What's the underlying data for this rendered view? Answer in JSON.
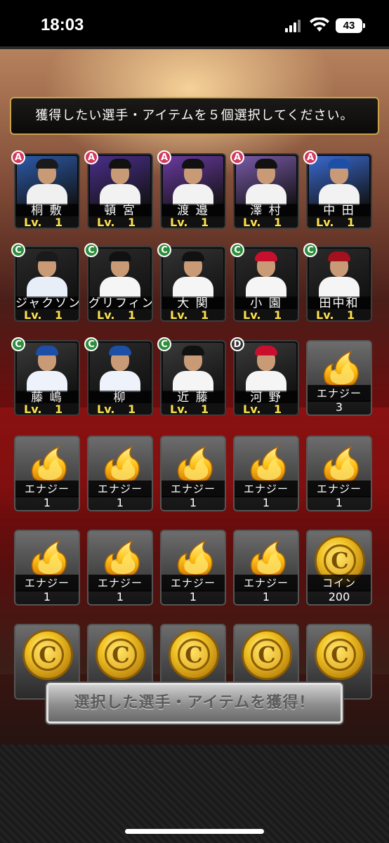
{
  "status": {
    "time": "18:03",
    "battery": "43"
  },
  "instruction": "獲得したい選手・アイテムを５個選択してください。",
  "players": [
    {
      "rank": "A",
      "name": "桐 敷",
      "lv_label": "Lv.",
      "lv": "1",
      "cap_color": "#1a1a1a",
      "bg": "#2c5aa8",
      "body_color": "#f0f0f0"
    },
    {
      "rank": "A",
      "name": "頓 宮",
      "lv_label": "Lv.",
      "lv": "1",
      "cap_color": "#111111",
      "bg": "#4a2e8a",
      "body_color": "#f2f2f2"
    },
    {
      "rank": "A",
      "name": "渡 邉",
      "lv_label": "Lv.",
      "lv": "1",
      "cap_color": "#111111",
      "bg": "#6a3aa0",
      "body_color": "#f2f2f2"
    },
    {
      "rank": "A",
      "name": "澤 村",
      "lv_label": "Lv.",
      "lv": "1",
      "cap_color": "#111111",
      "bg": "#7a5aa8",
      "body_color": "#f2f2f2"
    },
    {
      "rank": "A",
      "name": "中 田",
      "lv_label": "Lv.",
      "lv": "1",
      "cap_color": "#1d4fa6",
      "bg": "#3a6ad0",
      "body_color": "#f2f2f2"
    },
    {
      "rank": "C",
      "name": "ジャクソン",
      "lv_label": "Lv.",
      "lv": "1",
      "cap_color": "#1a1a1a",
      "bg": "#2a2a2a",
      "body_color": "#e8eef8"
    },
    {
      "rank": "C",
      "name": "グリフィン",
      "lv_label": "Lv.",
      "lv": "1",
      "cap_color": "#111111",
      "bg": "#2a2a2a",
      "body_color": "#f5f5f5"
    },
    {
      "rank": "C",
      "name": "大 関",
      "lv_label": "Lv.",
      "lv": "1",
      "cap_color": "#111111",
      "bg": "#333333",
      "body_color": "#f5f5f5"
    },
    {
      "rank": "C",
      "name": "小 園",
      "lv_label": "Lv.",
      "lv": "1",
      "cap_color": "#c8102e",
      "bg": "#2a2a2a",
      "body_color": "#f5f5f5"
    },
    {
      "rank": "C",
      "name": "田中和",
      "lv_label": "Lv.",
      "lv": "1",
      "cap_color": "#a3101e",
      "bg": "#2a2a2a",
      "body_color": "#f5f5f5"
    },
    {
      "rank": "C",
      "name": "藤 嶋",
      "lv_label": "Lv.",
      "lv": "1",
      "cap_color": "#1d4fa6",
      "bg": "#3a3a3a",
      "body_color": "#eef3fb"
    },
    {
      "rank": "C",
      "name": "柳",
      "lv_label": "Lv.",
      "lv": "1",
      "cap_color": "#1d4fa6",
      "bg": "#2a2a2a",
      "body_color": "#eef3fb"
    },
    {
      "rank": "C",
      "name": "近 藤",
      "lv_label": "Lv.",
      "lv": "1",
      "cap_color": "#111111",
      "bg": "#3a3a3a",
      "body_color": "#f5f5f5"
    },
    {
      "rank": "D",
      "name": "河 野",
      "lv_label": "Lv.",
      "lv": "1",
      "cap_color": "#c8102e",
      "bg": "#3a3a3a",
      "body_color": "#f5f5f5"
    }
  ],
  "items": [
    {
      "kind": "energy",
      "label": "エナジー",
      "qty": "3"
    },
    {
      "kind": "energy",
      "label": "エナジー",
      "qty": "1"
    },
    {
      "kind": "energy",
      "label": "エナジー",
      "qty": "1"
    },
    {
      "kind": "energy",
      "label": "エナジー",
      "qty": "1"
    },
    {
      "kind": "energy",
      "label": "エナジー",
      "qty": "1"
    },
    {
      "kind": "energy",
      "label": "エナジー",
      "qty": "1"
    },
    {
      "kind": "energy",
      "label": "エナジー",
      "qty": "1"
    },
    {
      "kind": "energy",
      "label": "エナジー",
      "qty": "1"
    },
    {
      "kind": "energy",
      "label": "エナジー",
      "qty": "1"
    },
    {
      "kind": "energy",
      "label": "エナジー",
      "qty": "1"
    },
    {
      "kind": "coin",
      "label": "コイン",
      "qty": "200",
      "symbol": "C"
    },
    {
      "kind": "coin",
      "label": "",
      "qty": "",
      "symbol": "C"
    },
    {
      "kind": "coin",
      "label": "",
      "qty": "",
      "symbol": "C"
    },
    {
      "kind": "coin",
      "label": "",
      "qty": "",
      "symbol": "C"
    },
    {
      "kind": "coin",
      "label": "",
      "qty": "",
      "symbol": "C"
    },
    {
      "kind": "coin",
      "label": "",
      "qty": "",
      "symbol": "C"
    }
  ],
  "action_button": "選択した選手・アイテムを獲得！"
}
